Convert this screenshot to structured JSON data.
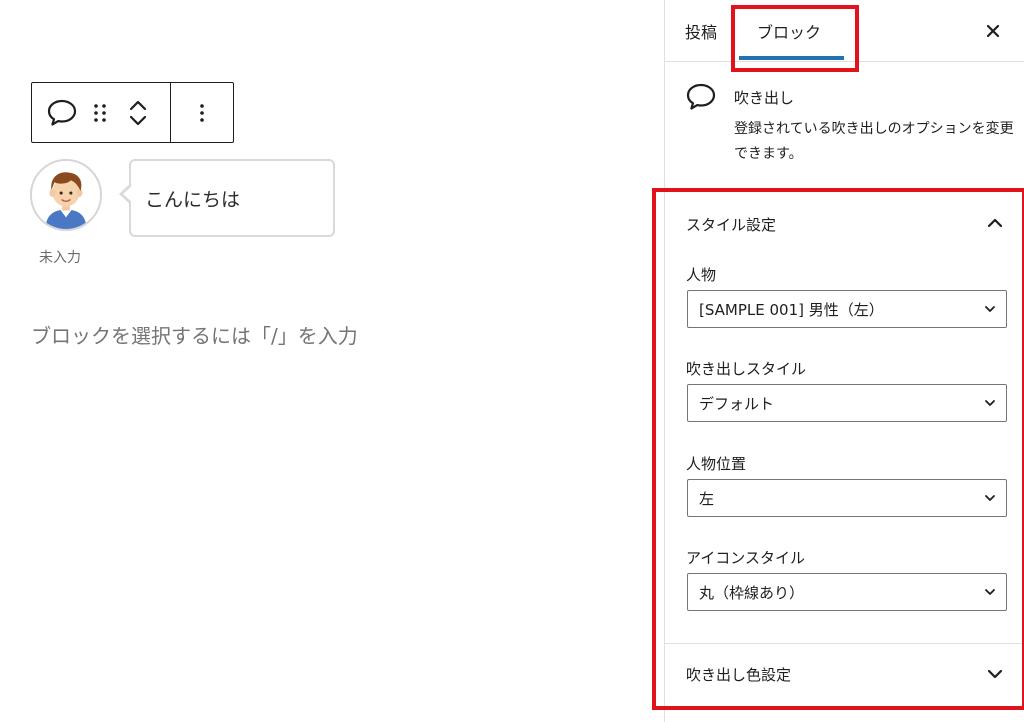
{
  "editor": {
    "balloon_text": "こんにちは",
    "avatar_name": "未入力",
    "placeholder": "ブロックを選択するには「/」を入力"
  },
  "sidebar": {
    "tabs": [
      {
        "label": "投稿",
        "active": false
      },
      {
        "label": "ブロック",
        "active": true
      }
    ],
    "card": {
      "title": "吹き出し",
      "description": "登録されている吹き出しのオプションを変更できます。"
    },
    "style_panel": {
      "title": "スタイル設定",
      "expanded": true,
      "fields": [
        {
          "label": "人物",
          "value": "[SAMPLE 001] 男性（左）"
        },
        {
          "label": "吹き出しスタイル",
          "value": "デフォルト"
        },
        {
          "label": "人物位置",
          "value": "左"
        },
        {
          "label": "アイコンスタイル",
          "value": "丸（枠線あり）"
        }
      ]
    },
    "color_panel": {
      "title": "吹き出し色設定",
      "expanded": false
    }
  },
  "colors": {
    "accent": "#2271b1",
    "highlight": "#e0121b",
    "border": "#e0e0e0",
    "placeholder": "#757575"
  },
  "icons": [
    "speech-bubble-icon",
    "drag-handle-icon",
    "chevron-up-icon",
    "chevron-down-icon",
    "more-vertical-icon",
    "close-icon",
    "chevron-up-icon",
    "chevron-down-icon"
  ]
}
